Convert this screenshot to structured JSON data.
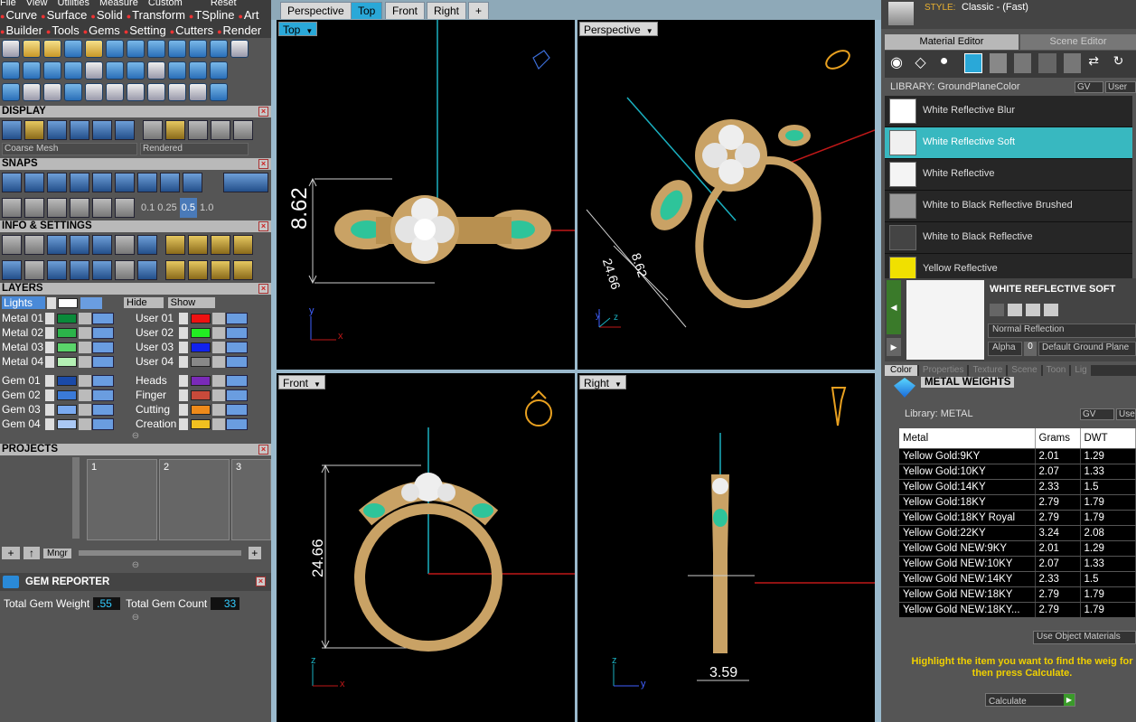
{
  "menu": [
    "File",
    "View",
    "Utilities",
    "Measure",
    "Custom",
    "Reset"
  ],
  "categories_row1": [
    "Curve",
    "Surface",
    "Solid",
    "Transform",
    "TSpline",
    "Art"
  ],
  "categories_row2": [
    "Builder",
    "Tools",
    "Gems",
    "Setting",
    "Cutters",
    "Render"
  ],
  "display": {
    "title": "DISPLAY",
    "mesh_select": "Coarse Mesh",
    "render_select": "Rendered"
  },
  "snaps": {
    "title": "SNAPS",
    "values": [
      "0.1",
      "0.25",
      "0.5",
      "1.0"
    ]
  },
  "info_settings": {
    "title": "INFO & SETTINGS"
  },
  "layers": {
    "title": "LAYERS",
    "lights": "Lights",
    "hide": "Hide",
    "show": "Show",
    "left": [
      {
        "name": "Metal 01",
        "color": "#0a8a3a"
      },
      {
        "name": "Metal 02",
        "color": "#2cb44a"
      },
      {
        "name": "Metal 03",
        "color": "#5ad46a"
      },
      {
        "name": "Metal 04",
        "color": "#b4f0b4"
      },
      {
        "name": "Gem 01",
        "color": "#1a4aa8"
      },
      {
        "name": "Gem 02",
        "color": "#3a7ad8"
      },
      {
        "name": "Gem 03",
        "color": "#7aaaf0"
      },
      {
        "name": "Gem 04",
        "color": "#aac8f4"
      }
    ],
    "right": [
      {
        "name": "User 01",
        "color": "#ee1111"
      },
      {
        "name": "User 02",
        "color": "#22ee22"
      },
      {
        "name": "User 03",
        "color": "#1122ee"
      },
      {
        "name": "User 04",
        "color": "#888888"
      },
      {
        "name": "Heads",
        "color": "#7a2ab8"
      },
      {
        "name": "Finger",
        "color": "#c84a3a"
      },
      {
        "name": "Cutting",
        "color": "#ee8a1a"
      },
      {
        "name": "Creation",
        "color": "#f0c020"
      }
    ]
  },
  "projects": {
    "title": "PROJECTS",
    "slots": [
      "1",
      "2",
      "3"
    ],
    "mngr": "Mngr"
  },
  "gem_reporter": {
    "title": "GEM REPORTER",
    "weight_label": "Total Gem Weight",
    "weight_value": ".55",
    "count_label": "Total Gem Count",
    "count_value": "33"
  },
  "view_tabs": [
    "Perspective",
    "Top",
    "Front",
    "Right",
    "+"
  ],
  "active_view_tab": "Top",
  "viewports": {
    "top": {
      "label": "Top",
      "dim": "8.62"
    },
    "perspective": {
      "label": "Perspective",
      "dim1": "24.66",
      "dim2": "8.62"
    },
    "front": {
      "label": "Front",
      "dim": "24.66"
    },
    "right": {
      "label": "Right",
      "dim": "3.59"
    }
  },
  "style": {
    "label": "STYLE:",
    "value": "Classic - (Fast)"
  },
  "right_tabs": {
    "material_editor": "Material Editor",
    "scene_editor": "Scene Editor"
  },
  "library": {
    "label": "LIBRARY: GroundPlaneColor",
    "gv": "GV",
    "user": "User"
  },
  "materials": [
    {
      "name": "White Reflective Blur",
      "color": "#ffffff"
    },
    {
      "name": "White Reflective Soft",
      "color": "#f0f0f0"
    },
    {
      "name": "White Reflective",
      "color": "#f4f4f4"
    },
    {
      "name": "White to Black Reflective Brushed",
      "color": "#9a9a9a"
    },
    {
      "name": "White to Black Reflective",
      "color": "#444444"
    },
    {
      "name": "Yellow Reflective",
      "color": "#f0e000"
    }
  ],
  "selected_material": {
    "title": "WHITE REFLECTIVE SOFT",
    "reflection": "Normal Reflection",
    "alpha": "Alpha",
    "alpha_value": "0",
    "ground": "Default Ground Plane"
  },
  "prop_tabs": [
    "Color",
    "Properties",
    "Texture",
    "Scene",
    "Toon",
    "Lig"
  ],
  "metal_weights": {
    "title": "METAL WEIGHTS",
    "library": "Library: METAL",
    "gv": "GV",
    "user": "Use",
    "headers": [
      "Metal",
      "Grams",
      "DWT"
    ],
    "rows": [
      [
        "Yellow Gold:9KY",
        "2.01",
        "1.29"
      ],
      [
        "Yellow Gold:10KY",
        "2.07",
        "1.33"
      ],
      [
        "Yellow Gold:14KY",
        "2.33",
        "1.5"
      ],
      [
        "Yellow Gold:18KY",
        "2.79",
        "1.79"
      ],
      [
        "Yellow Gold:18KY Royal",
        "2.79",
        "1.79"
      ],
      [
        "Yellow Gold:22KY",
        "3.24",
        "2.08"
      ],
      [
        "Yellow Gold NEW:9KY",
        "2.01",
        "1.29"
      ],
      [
        "Yellow Gold NEW:10KY",
        "2.07",
        "1.33"
      ],
      [
        "Yellow Gold NEW:14KY",
        "2.33",
        "1.5"
      ],
      [
        "Yellow Gold NEW:18KY",
        "2.79",
        "1.79"
      ],
      [
        "Yellow Gold NEW:18KY...",
        "2.79",
        "1.79"
      ]
    ],
    "use_object": "Use Object Materials",
    "hint": "Highlight the item you want to find the weig for then press Calculate.",
    "calculate": "Calculate"
  },
  "colors": {
    "accent": "#2aa8d8",
    "metal": "#c9a265",
    "gem_green": "#2ec49a",
    "axis_red": "#d02020",
    "axis_cyan": "#1ab0c0"
  }
}
